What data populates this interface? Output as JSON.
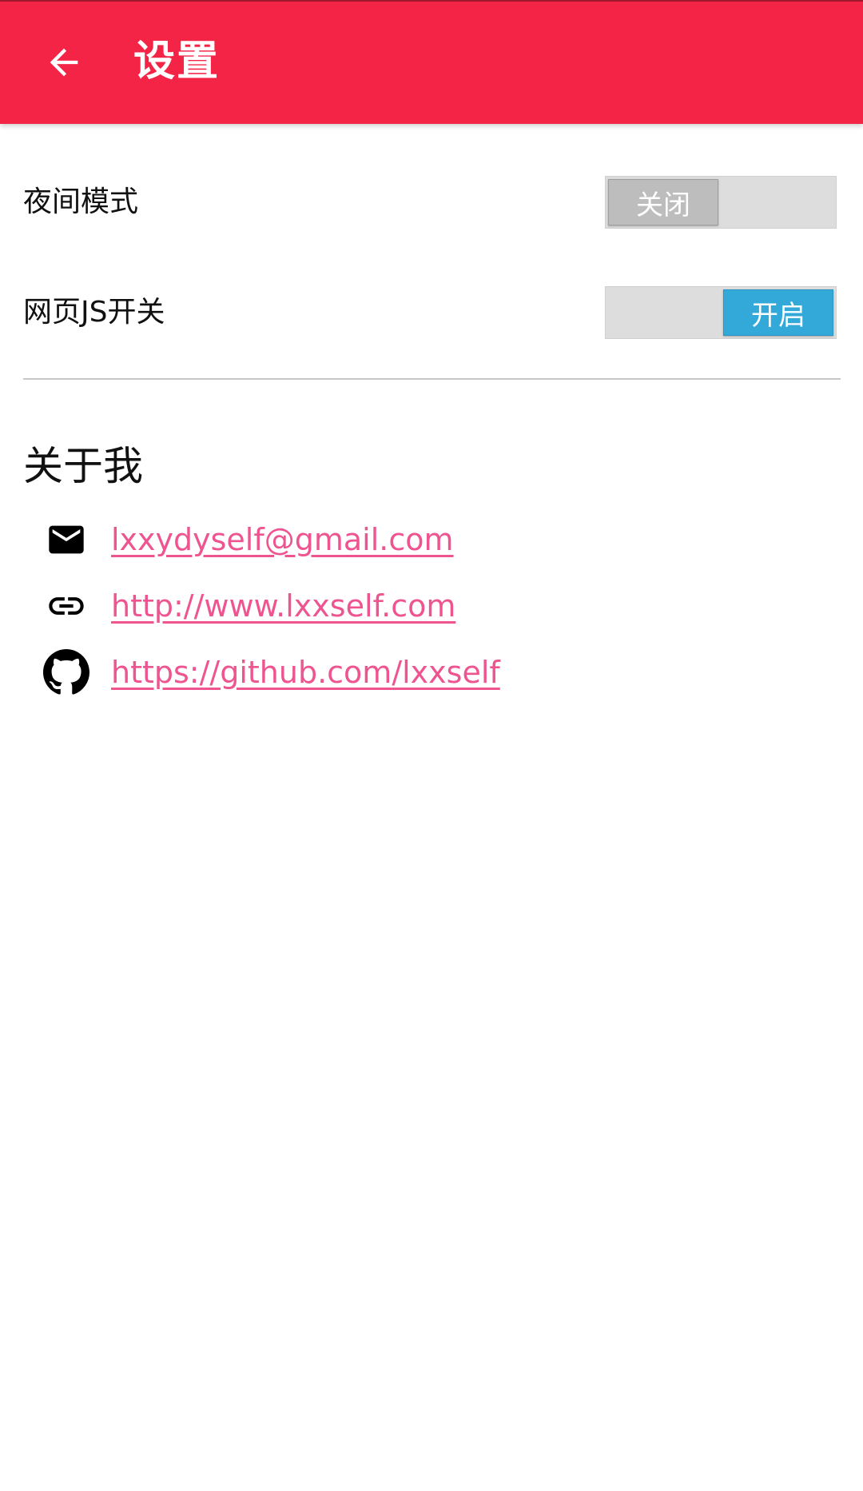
{
  "toolbar": {
    "title": "设置",
    "back_icon": "arrow-back-icon",
    "color": "#F42447"
  },
  "settings": [
    {
      "label": "夜间模式",
      "toggle_text": "关闭",
      "state": "off"
    },
    {
      "label": "网页JS开关",
      "toggle_text": "开启",
      "state": "on"
    }
  ],
  "about": {
    "title": "关于我",
    "links": [
      {
        "icon": "mail-icon",
        "text": "lxxydyself@gmail.com"
      },
      {
        "icon": "link-icon",
        "text": "http://www.lxxself.com"
      },
      {
        "icon": "github-icon",
        "text": "https://github.com/lxxself"
      }
    ]
  },
  "colors": {
    "accent": "#F42447",
    "link": "#EE5590",
    "toggle_on": "#33A9D9",
    "toggle_off": "#BDBDBD"
  }
}
